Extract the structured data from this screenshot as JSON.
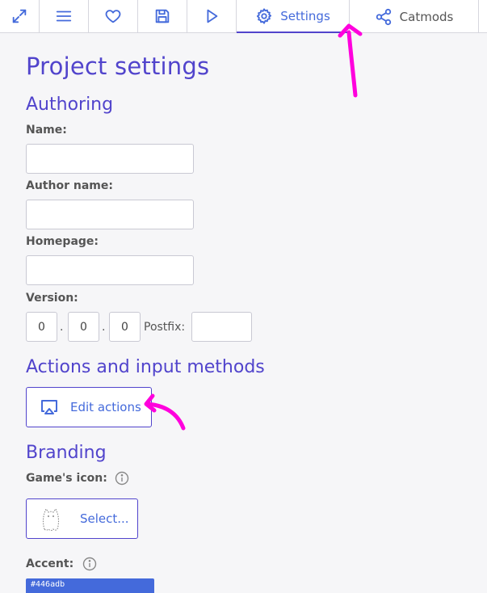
{
  "toolbar": {
    "fullscreen_icon": "expand-arrows-icon",
    "menu_icon": "hamburger-icon",
    "like_icon": "heart-icon",
    "save_icon": "floppy-disk-icon",
    "play_icon": "play-icon",
    "tabs": [
      {
        "label": "Settings",
        "icon": "gear-icon",
        "active": true
      },
      {
        "label": "Catmods",
        "icon": "share-nodes-icon",
        "active": false
      }
    ]
  },
  "page": {
    "title": "Project settings"
  },
  "authoring": {
    "heading": "Authoring",
    "name_label": "Name:",
    "name_value": "",
    "author_label": "Author name:",
    "author_value": "",
    "homepage_label": "Homepage:",
    "homepage_value": "",
    "version_label": "Version:",
    "version_major": "0",
    "version_minor": "0",
    "version_patch": "0",
    "version_sep": ".",
    "postfix_label": "Postfix:",
    "postfix_value": ""
  },
  "actions": {
    "heading": "Actions and input methods",
    "edit_button_label": "Edit actions",
    "edit_button_icon": "airplay-icon"
  },
  "branding": {
    "heading": "Branding",
    "icon_label": "Game's icon:",
    "select_button_label": "Select...",
    "select_button_icon": "ghost-cat-icon",
    "accent_label": "Accent:",
    "accent_value": "#446adb"
  },
  "colors": {
    "heading": "#5144cc",
    "accent": "#446adb",
    "annotation": "#ff00dd"
  }
}
